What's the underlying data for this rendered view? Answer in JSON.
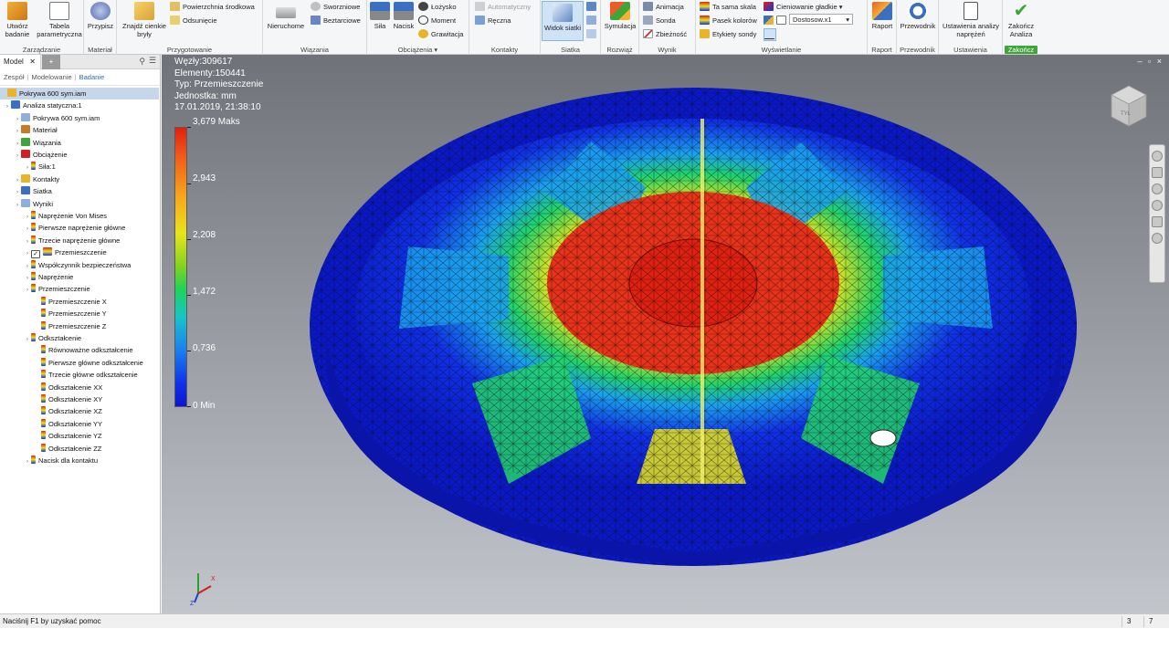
{
  "ribbon": {
    "groups": [
      {
        "label": "Zarządzanie",
        "buttons": [
          "Utwórz badanie",
          "Tabela parametryczna"
        ]
      },
      {
        "label": "Materiał",
        "buttons": [
          "Przypisz"
        ]
      },
      {
        "label": "Przygotowanie",
        "buttons": [
          "Znajdź cienkie bryły",
          "Powierzchnia środkowa",
          "Odsunięcie"
        ]
      },
      {
        "label": "Wiązania",
        "buttons": [
          "Nieruchome",
          "Sworzniowe",
          "Beztarciowe"
        ]
      },
      {
        "label": "Obciążenia",
        "buttons": [
          "Siła",
          "Nacisk",
          "Łożysko",
          "Moment",
          "Grawitacja"
        ]
      },
      {
        "label": "Kontakty",
        "buttons": [
          "Automatyczny",
          "Ręczna"
        ]
      },
      {
        "label": "Siatka",
        "buttons": [
          "Widok siatki"
        ]
      },
      {
        "label": "Rozwiąż",
        "buttons": [
          "Symulacja"
        ]
      },
      {
        "label": "Wynik",
        "buttons": [
          "Animacja",
          "Sonda",
          "Zbieżność"
        ]
      },
      {
        "label": "Wyświetlanie",
        "buttons": [
          "Ta sama skala",
          "Pasek kolorów",
          "Etykiety sondy",
          "Cieniowanie gładkie",
          "Dostosow.x1"
        ]
      },
      {
        "label": "Raport",
        "buttons": [
          "Raport"
        ]
      },
      {
        "label": "Przewodnik",
        "buttons": [
          "Przewodnik"
        ]
      },
      {
        "label": "Ustawienia",
        "buttons": [
          "Ustawienia analizy naprężeń"
        ]
      },
      {
        "label": "Zakończ",
        "buttons": [
          "Zakończ Analiza"
        ]
      }
    ],
    "btn": {
      "create_study": "Utwórz badanie",
      "param_table": "Tabela parametryczna",
      "assign": "Przypisz",
      "find_thin": "Znajdź cienkie bryły",
      "midsurface": "Powierzchnia środkowa",
      "offset": "Odsunięcie",
      "fixed": "Nieruchome",
      "pin": "Sworzniowe",
      "frictionless": "Beztarciowe",
      "force": "Siła",
      "pressure": "Nacisk",
      "bearing": "Łożysko",
      "moment": "Moment",
      "gravity": "Grawitacja",
      "automatic": "Automatyczny",
      "manual": "Ręczna",
      "mesh_view": "Widok siatki",
      "simulate": "Symulacja",
      "animate": "Animacja",
      "probe": "Sonda",
      "convergence": "Zbieżność",
      "same_scale": "Ta sama skala",
      "color_bar": "Pasek kolorów",
      "probe_labels": "Etykiety sondy",
      "smooth_shading": "Cieniowanie gładkie",
      "scale_select": "Dostosow.x1",
      "report": "Raport",
      "guide": "Przewodnik",
      "stress_settings": "Ustawienia analizy naprężeń",
      "finish": "Zakończ Analiza"
    }
  },
  "panel": {
    "tab_model": "Model",
    "tab_add": "+",
    "modes": [
      "Zespół",
      "Modelowanie",
      "Badanie"
    ],
    "tree": [
      {
        "label": "Pokrywa 600 sym.iam",
        "level": 0,
        "root": true
      },
      {
        "label": "Analiza statyczna:1",
        "level": 0
      },
      {
        "label": "Pokrywa 600 sym.iam",
        "level": 1
      },
      {
        "label": "Materiał",
        "level": 1
      },
      {
        "label": "Wiązania",
        "level": 1
      },
      {
        "label": "Obciążenie",
        "level": 1
      },
      {
        "label": "Siła:1",
        "level": 2
      },
      {
        "label": "Kontakty",
        "level": 1
      },
      {
        "label": "Siatka",
        "level": 1
      },
      {
        "label": "Wyniki",
        "level": 1
      },
      {
        "label": "Naprężenie Von Mises",
        "level": 2
      },
      {
        "label": "Pierwsze naprężenie główne",
        "level": 2
      },
      {
        "label": "Trzecie naprężenie główne",
        "level": 2
      },
      {
        "label": "Przemieszczenie",
        "level": 2,
        "checked": true
      },
      {
        "label": "Współczynnik bezpieczeństwa",
        "level": 2
      },
      {
        "label": "Naprężenie",
        "level": 2
      },
      {
        "label": "Przemieszczenie",
        "level": 2
      },
      {
        "label": "Przemieszczenie X",
        "level": 3
      },
      {
        "label": "Przemieszczenie Y",
        "level": 3
      },
      {
        "label": "Przemieszczenie Z",
        "level": 3
      },
      {
        "label": "Odkształcenie",
        "level": 2
      },
      {
        "label": "Równoważne odkształcenie",
        "level": 3
      },
      {
        "label": "Pierwsze główne odkształcenie",
        "level": 3
      },
      {
        "label": "Trzecie główne odkształcenie",
        "level": 3
      },
      {
        "label": "Odkształcenie XX",
        "level": 3
      },
      {
        "label": "Odkształcenie XY",
        "level": 3
      },
      {
        "label": "Odkształcenie XZ",
        "level": 3
      },
      {
        "label": "Odkształcenie YY",
        "level": 3
      },
      {
        "label": "Odkształcenie YZ",
        "level": 3
      },
      {
        "label": "Odkształcenie ZZ",
        "level": 3
      },
      {
        "label": "Nacisk dla kontaktu",
        "level": 2
      }
    ]
  },
  "viewport": {
    "nodes": "Węzły:309617",
    "elements": "Elementy:150441",
    "type": "Typ: Przemieszczenie",
    "unit": "Jednostka: mm",
    "datetime": "17.01.2019, 21:38:10",
    "legend": {
      "max_label": "3,679 Maks",
      "min_label": "0 Min",
      "ticks": [
        "2,943",
        "2,208",
        "1,472",
        "0,736"
      ],
      "colors": {
        "max": "#e02010",
        "min": "#0a18d0"
      }
    },
    "win_controls": "– ▫ ×",
    "cube_face": "TYŁ"
  },
  "status": {
    "help": "Naciśnij F1 by uzyskać pomoc",
    "n1": "3",
    "n2": "7"
  }
}
